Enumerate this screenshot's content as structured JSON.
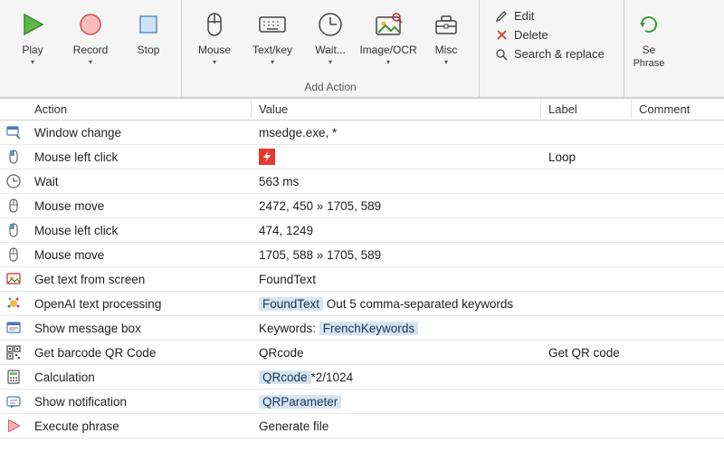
{
  "ribbon": {
    "groups": {
      "playback": {
        "play": "Play",
        "record": "Record",
        "stop": "Stop"
      },
      "add_action": {
        "label": "Add Action",
        "mouse": "Mouse",
        "textkey": "Text/key",
        "wait": "Wait...",
        "imageocr": "Image/OCR",
        "misc": "Misc"
      },
      "edit_panel": {
        "edit": "Edit",
        "delete": "Delete",
        "search_replace": "Search & replace"
      },
      "phrase": {
        "label": "Se",
        "sub": "Phrase"
      }
    }
  },
  "table": {
    "headers": {
      "action": "Action",
      "value": "Value",
      "label": "Label",
      "comment": "Comment"
    },
    "rows": [
      {
        "icon": "window-change",
        "action": "Window change",
        "value_plain": "msedge.exe, *",
        "label": "",
        "comment": ""
      },
      {
        "icon": "mouse-click",
        "action": "Mouse left click",
        "value_special": "redbolt",
        "label": "Loop",
        "comment": ""
      },
      {
        "icon": "clock",
        "action": "Wait",
        "value_plain": "563 ms",
        "label": "",
        "comment": ""
      },
      {
        "icon": "mouse-move",
        "action": "Mouse move",
        "value_plain": "2472, 450 » 1705, 589",
        "label": "",
        "comment": ""
      },
      {
        "icon": "mouse-click",
        "action": "Mouse left click",
        "value_plain": "474, 1249",
        "label": "",
        "comment": ""
      },
      {
        "icon": "mouse-move",
        "action": "Mouse move",
        "value_plain": "1705, 588 » 1705, 589",
        "label": "",
        "comment": ""
      },
      {
        "icon": "ocr",
        "action": "Get text from screen",
        "value_plain": "FoundText",
        "label": "",
        "comment": ""
      },
      {
        "icon": "openai",
        "action": "OpenAI text processing",
        "value_segments": [
          {
            "t": "chip",
            "v": "FoundText"
          },
          {
            "t": "text",
            "v": " Out 5 comma-separated keywords"
          }
        ],
        "label": "",
        "comment": ""
      },
      {
        "icon": "msgbox",
        "action": "Show message box",
        "value_segments": [
          {
            "t": "text",
            "v": "Keywords: "
          },
          {
            "t": "chip",
            "v": "FrenchKeywords"
          }
        ],
        "label": "",
        "comment": ""
      },
      {
        "icon": "qrcode",
        "action": "Get barcode QR Code",
        "value_plain": "QRcode",
        "label": "Get QR code",
        "comment": ""
      },
      {
        "icon": "calc",
        "action": "Calculation",
        "value_segments": [
          {
            "t": "chip",
            "v": "QRcode"
          },
          {
            "t": "text",
            "v": "*2/1024"
          }
        ],
        "label": "",
        "comment": ""
      },
      {
        "icon": "notify",
        "action": "Show notification",
        "value_segments": [
          {
            "t": "chip",
            "v": "QRParameter"
          }
        ],
        "label": "",
        "comment": ""
      },
      {
        "icon": "exec",
        "action": "Execute phrase",
        "value_plain": "Generate file",
        "label": "",
        "comment": ""
      }
    ]
  }
}
